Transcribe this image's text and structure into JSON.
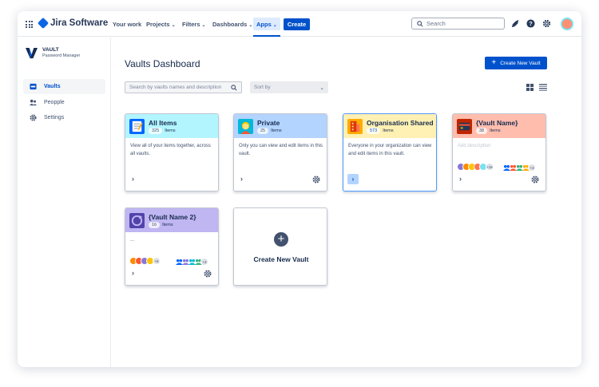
{
  "topnav": {
    "logo_text": "Jira Software",
    "your_work": "Your work",
    "projects": "Projects",
    "filters": "Filters",
    "dashboards": "Dashboards",
    "apps": "Apps",
    "create": "Create",
    "search_placeholder": "Search",
    "chevron": "⌄"
  },
  "sidebar": {
    "brand_name": "VAULT",
    "brand_sub": "Password Manager",
    "items": [
      {
        "label": "Vaults",
        "icon": "vault-icon",
        "active": true
      },
      {
        "label": "Peopple",
        "icon": "people-icon",
        "active": false
      },
      {
        "label": "Settings",
        "icon": "gear-icon",
        "active": false
      }
    ]
  },
  "main": {
    "title": "Vaults Dashboard",
    "create_new_vault": "Create New Vault",
    "search_placeholder": "Search by vaults names and description",
    "sort_placeholder": "Sort by",
    "items_label": "Items",
    "create_card_label": "Create New Vault"
  },
  "vaults": [
    {
      "name": "All Items",
      "count": "325",
      "desc": "View all of your items together, across all vaults.",
      "color": "#b3f5ff"
    },
    {
      "name": "Private",
      "count": "25",
      "desc": "Only you can view and edit items in this vault.",
      "color": "#b3d4ff"
    },
    {
      "name": "Organisation Shared",
      "count": "573",
      "desc": "Everyone in your organization can view and edit items in this vault.",
      "color": "#fff0b3"
    },
    {
      "name": "{Vault Name}",
      "count": "38",
      "desc": "Add description",
      "color": "#ffbdad",
      "avatars_more": "+16",
      "groups_more": "+3"
    },
    {
      "name": "{Vault Name 2}",
      "count": "16",
      "desc": "...",
      "color": "#c0b6f2",
      "avatars_more": "+6",
      "groups_more": "+3"
    }
  ]
}
